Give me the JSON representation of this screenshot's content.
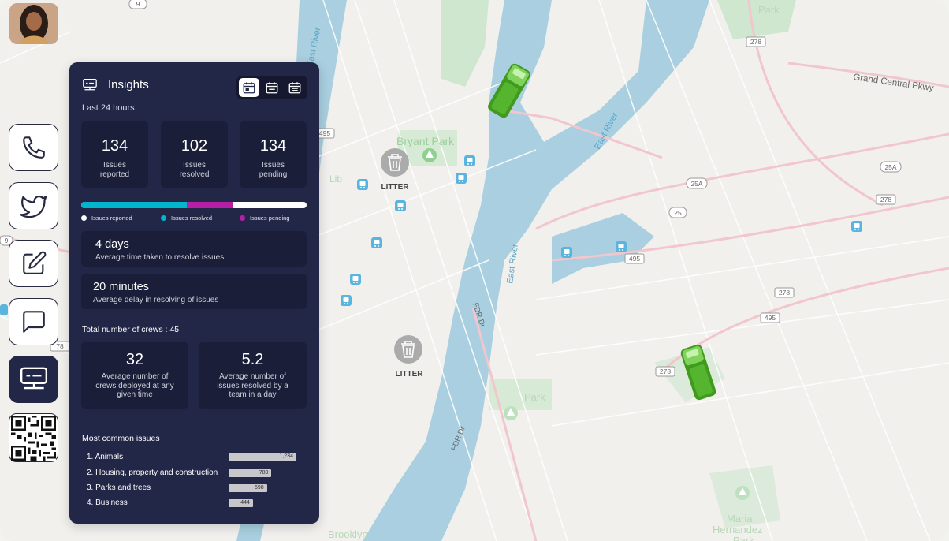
{
  "rail": {
    "avatar": "user-avatar",
    "items": [
      "phone-icon",
      "twitter-icon",
      "edit-icon",
      "chat-icon",
      "insights-icon"
    ],
    "qr": "qr-code"
  },
  "map": {
    "labels": {
      "bryant_park": "Bryant Park",
      "east_river_1": "East River",
      "east_river_2": "East River",
      "east_river_3": "East River",
      "grand_central": "Grand Central Pkwy",
      "fdr_1": "FDR Dr",
      "fdr_2": "FDR Dr",
      "litter_1": "LITTER",
      "litter_2": "LITTER",
      "park_top": "Park",
      "maria": "Maria",
      "hernandez": "Hernandez",
      "park_bottom": "Park",
      "brooklyn": "Brooklyn",
      "lib": "Lib",
      "park_mid": "Park"
    },
    "shields": {
      "s9": "9",
      "s278a": "278",
      "s25a_1": "25A",
      "s25a_2": "25A",
      "s25": "25",
      "s278b": "278",
      "s495a": "495",
      "s278c": "278",
      "s495b": "495",
      "s278d": "278",
      "s495c": "495",
      "s78": "78",
      "s9b": "9"
    }
  },
  "panel": {
    "title": "Insights",
    "subtitle": "Last 24 hours",
    "stats": [
      {
        "value": "134",
        "label_line1": "Issues",
        "label_line2": "reported"
      },
      {
        "value": "102",
        "label_line1": "Issues",
        "label_line2": "resolved"
      },
      {
        "value": "134",
        "label_line1": "Issues",
        "label_line2": "pending"
      }
    ],
    "progress": {
      "reported_fraction": 0.47,
      "resolved_fraction": 0.2,
      "pending_fraction": 0.33,
      "colors": {
        "reported": "#00b5cc",
        "resolved": "#b51ea5",
        "pending": "#ffffff"
      }
    },
    "legend": [
      "Issues reported",
      "Issues resolved",
      "Issues pending"
    ],
    "resolve_time": {
      "value": "4 days",
      "label": "Average time taken to resolve issues"
    },
    "delay": {
      "value": "20 minutes",
      "label": "Average delay in resolving of issues"
    },
    "crews_total": "Total number of crews : 45",
    "crews": [
      {
        "value": "32",
        "label": "Average number of crews deployed at any given time"
      },
      {
        "value": "5.2",
        "label": "Average number of issues resolved by a team in a day"
      }
    ],
    "common_title": "Most common issues",
    "issues": [
      {
        "label": "1. Animals",
        "value": "1,234",
        "num": 1234
      },
      {
        "label": "2. Housing, property and construction",
        "value": "780",
        "num": 780
      },
      {
        "label": "3. Parks and trees",
        "value": "698",
        "num": 698
      },
      {
        "label": "4. Business",
        "value": "444",
        "num": 444
      }
    ]
  }
}
